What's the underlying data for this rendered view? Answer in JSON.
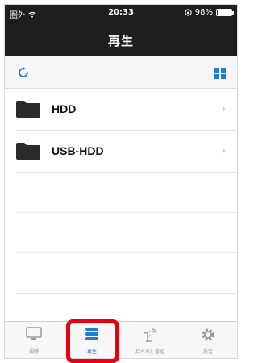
{
  "status_bar": {
    "carrier": "圏外",
    "time": "20:33",
    "battery": "98%",
    "battery_level": 0.98
  },
  "nav": {
    "title": "再生"
  },
  "toolbar": {
    "refresh_icon": "refresh-icon",
    "grid_icon": "grid-view-icon"
  },
  "list": {
    "items": [
      {
        "label": "HDD",
        "icon": "folder-icon"
      },
      {
        "label": "USB-HDD",
        "icon": "folder-icon"
      }
    ]
  },
  "tabs": [
    {
      "label": "視聴",
      "icon": "tv-icon",
      "active": false
    },
    {
      "label": "再生",
      "icon": "stack-icon",
      "active": true
    },
    {
      "label": "持ち出し番組",
      "icon": "antenna-icon",
      "active": false
    },
    {
      "label": "設定",
      "icon": "gear-icon",
      "active": false
    }
  ],
  "colors": {
    "accent": "#1f7bd8",
    "highlight": "#e60012",
    "header_bg": "#1e1e1e"
  }
}
